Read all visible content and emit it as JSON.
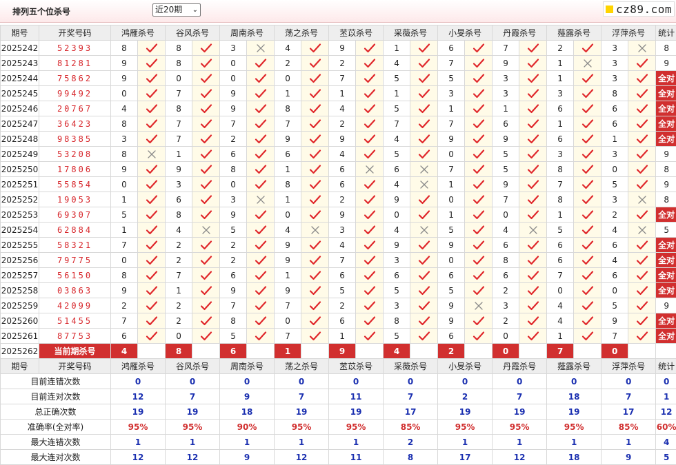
{
  "header": {
    "title": "排列五个位杀号",
    "range_selected": "近20期",
    "logo_text": "cz89.com"
  },
  "colors": {
    "accent_red": "#d12f2f",
    "draw_red": "#d7262b",
    "stat_blue": "#1a2fb0",
    "mark_bg": "#fffbe8",
    "logo_yellow": "#ffd400"
  },
  "columns": {
    "period": "期号",
    "draw": "开奖号码",
    "experts": [
      "鸿雁杀号",
      "谷风杀号",
      "周南杀号",
      "荡之杀号",
      "苤苡杀号",
      "采薇杀号",
      "小旻杀号",
      "丹霞杀号",
      "薤露杀号",
      "浮萍杀号"
    ],
    "stat": "统计"
  },
  "rows": [
    {
      "period": "2025242",
      "draw": "52393",
      "kills": [
        [
          8,
          1
        ],
        [
          8,
          1
        ],
        [
          3,
          0
        ],
        [
          4,
          1
        ],
        [
          9,
          1
        ],
        [
          1,
          1
        ],
        [
          6,
          1
        ],
        [
          7,
          1
        ],
        [
          2,
          1
        ],
        [
          3,
          0
        ]
      ],
      "stat": "8"
    },
    {
      "period": "2025243",
      "draw": "81281",
      "kills": [
        [
          9,
          1
        ],
        [
          8,
          1
        ],
        [
          0,
          1
        ],
        [
          2,
          1
        ],
        [
          2,
          1
        ],
        [
          4,
          1
        ],
        [
          7,
          1
        ],
        [
          9,
          1
        ],
        [
          1,
          0
        ],
        [
          3,
          1
        ]
      ],
      "stat": "9"
    },
    {
      "period": "2025244",
      "draw": "75862",
      "kills": [
        [
          9,
          1
        ],
        [
          0,
          1
        ],
        [
          0,
          1
        ],
        [
          0,
          1
        ],
        [
          7,
          1
        ],
        [
          5,
          1
        ],
        [
          5,
          1
        ],
        [
          3,
          1
        ],
        [
          1,
          1
        ],
        [
          3,
          1
        ]
      ],
      "stat": "全对"
    },
    {
      "period": "2025245",
      "draw": "99492",
      "kills": [
        [
          0,
          1
        ],
        [
          7,
          1
        ],
        [
          9,
          1
        ],
        [
          1,
          1
        ],
        [
          1,
          1
        ],
        [
          1,
          1
        ],
        [
          3,
          1
        ],
        [
          3,
          1
        ],
        [
          3,
          1
        ],
        [
          8,
          1
        ]
      ],
      "stat": "全对"
    },
    {
      "period": "2025246",
      "draw": "20767",
      "kills": [
        [
          4,
          1
        ],
        [
          8,
          1
        ],
        [
          9,
          1
        ],
        [
          8,
          1
        ],
        [
          4,
          1
        ],
        [
          5,
          1
        ],
        [
          1,
          1
        ],
        [
          1,
          1
        ],
        [
          6,
          1
        ],
        [
          6,
          1
        ]
      ],
      "stat": "全对"
    },
    {
      "period": "2025247",
      "draw": "36423",
      "kills": [
        [
          8,
          1
        ],
        [
          7,
          1
        ],
        [
          7,
          1
        ],
        [
          7,
          1
        ],
        [
          2,
          1
        ],
        [
          7,
          1
        ],
        [
          7,
          1
        ],
        [
          6,
          1
        ],
        [
          1,
          1
        ],
        [
          6,
          1
        ]
      ],
      "stat": "全对"
    },
    {
      "period": "2025248",
      "draw": "98385",
      "kills": [
        [
          3,
          1
        ],
        [
          7,
          1
        ],
        [
          2,
          1
        ],
        [
          9,
          1
        ],
        [
          9,
          1
        ],
        [
          4,
          1
        ],
        [
          9,
          1
        ],
        [
          9,
          1
        ],
        [
          6,
          1
        ],
        [
          1,
          1
        ]
      ],
      "stat": "全对"
    },
    {
      "period": "2025249",
      "draw": "53208",
      "kills": [
        [
          8,
          0
        ],
        [
          1,
          1
        ],
        [
          6,
          1
        ],
        [
          6,
          1
        ],
        [
          4,
          1
        ],
        [
          5,
          1
        ],
        [
          0,
          1
        ],
        [
          5,
          1
        ],
        [
          3,
          1
        ],
        [
          3,
          1
        ]
      ],
      "stat": "9"
    },
    {
      "period": "2025250",
      "draw": "17806",
      "kills": [
        [
          9,
          1
        ],
        [
          9,
          1
        ],
        [
          8,
          1
        ],
        [
          1,
          1
        ],
        [
          6,
          0
        ],
        [
          6,
          0
        ],
        [
          7,
          1
        ],
        [
          5,
          1
        ],
        [
          8,
          1
        ],
        [
          0,
          1
        ]
      ],
      "stat": "8"
    },
    {
      "period": "2025251",
      "draw": "55854",
      "kills": [
        [
          0,
          1
        ],
        [
          3,
          1
        ],
        [
          0,
          1
        ],
        [
          8,
          1
        ],
        [
          6,
          1
        ],
        [
          4,
          0
        ],
        [
          1,
          1
        ],
        [
          9,
          1
        ],
        [
          7,
          1
        ],
        [
          5,
          1
        ]
      ],
      "stat": "9"
    },
    {
      "period": "2025252",
      "draw": "19053",
      "kills": [
        [
          1,
          1
        ],
        [
          6,
          1
        ],
        [
          3,
          0
        ],
        [
          1,
          1
        ],
        [
          2,
          1
        ],
        [
          9,
          1
        ],
        [
          0,
          1
        ],
        [
          7,
          1
        ],
        [
          8,
          1
        ],
        [
          3,
          0
        ]
      ],
      "stat": "8"
    },
    {
      "period": "2025253",
      "draw": "69307",
      "kills": [
        [
          5,
          1
        ],
        [
          8,
          1
        ],
        [
          9,
          1
        ],
        [
          0,
          1
        ],
        [
          9,
          1
        ],
        [
          0,
          1
        ],
        [
          1,
          1
        ],
        [
          0,
          1
        ],
        [
          1,
          1
        ],
        [
          2,
          1
        ]
      ],
      "stat": "全对"
    },
    {
      "period": "2025254",
      "draw": "62884",
      "kills": [
        [
          1,
          1
        ],
        [
          4,
          0
        ],
        [
          5,
          1
        ],
        [
          4,
          0
        ],
        [
          3,
          1
        ],
        [
          4,
          0
        ],
        [
          5,
          1
        ],
        [
          4,
          0
        ],
        [
          5,
          1
        ],
        [
          4,
          0
        ]
      ],
      "stat": "5"
    },
    {
      "period": "2025255",
      "draw": "58321",
      "kills": [
        [
          7,
          1
        ],
        [
          2,
          1
        ],
        [
          2,
          1
        ],
        [
          9,
          1
        ],
        [
          4,
          1
        ],
        [
          9,
          1
        ],
        [
          9,
          1
        ],
        [
          6,
          1
        ],
        [
          6,
          1
        ],
        [
          6,
          1
        ]
      ],
      "stat": "全对"
    },
    {
      "period": "2025256",
      "draw": "79775",
      "kills": [
        [
          0,
          1
        ],
        [
          2,
          1
        ],
        [
          2,
          1
        ],
        [
          9,
          1
        ],
        [
          7,
          1
        ],
        [
          3,
          1
        ],
        [
          0,
          1
        ],
        [
          8,
          1
        ],
        [
          6,
          1
        ],
        [
          4,
          1
        ]
      ],
      "stat": "全对"
    },
    {
      "period": "2025257",
      "draw": "56150",
      "kills": [
        [
          8,
          1
        ],
        [
          7,
          1
        ],
        [
          6,
          1
        ],
        [
          1,
          1
        ],
        [
          6,
          1
        ],
        [
          6,
          1
        ],
        [
          6,
          1
        ],
        [
          6,
          1
        ],
        [
          7,
          1
        ],
        [
          6,
          1
        ]
      ],
      "stat": "全对"
    },
    {
      "period": "2025258",
      "draw": "03863",
      "kills": [
        [
          9,
          1
        ],
        [
          1,
          1
        ],
        [
          9,
          1
        ],
        [
          9,
          1
        ],
        [
          5,
          1
        ],
        [
          5,
          1
        ],
        [
          5,
          1
        ],
        [
          2,
          1
        ],
        [
          0,
          1
        ],
        [
          0,
          1
        ]
      ],
      "stat": "全对"
    },
    {
      "period": "2025259",
      "draw": "42099",
      "kills": [
        [
          2,
          1
        ],
        [
          2,
          1
        ],
        [
          7,
          1
        ],
        [
          7,
          1
        ],
        [
          2,
          1
        ],
        [
          3,
          1
        ],
        [
          9,
          0
        ],
        [
          3,
          1
        ],
        [
          4,
          1
        ],
        [
          5,
          1
        ]
      ],
      "stat": "9"
    },
    {
      "period": "2025260",
      "draw": "51455",
      "kills": [
        [
          7,
          1
        ],
        [
          2,
          1
        ],
        [
          8,
          1
        ],
        [
          0,
          1
        ],
        [
          6,
          1
        ],
        [
          8,
          1
        ],
        [
          9,
          1
        ],
        [
          2,
          1
        ],
        [
          4,
          1
        ],
        [
          9,
          1
        ]
      ],
      "stat": "全对"
    },
    {
      "period": "2025261",
      "draw": "87753",
      "kills": [
        [
          6,
          1
        ],
        [
          0,
          1
        ],
        [
          5,
          1
        ],
        [
          7,
          1
        ],
        [
          1,
          1
        ],
        [
          5,
          1
        ],
        [
          6,
          1
        ],
        [
          0,
          1
        ],
        [
          1,
          1
        ],
        [
          7,
          1
        ]
      ],
      "stat": "全对"
    }
  ],
  "current": {
    "period": "2025262",
    "label": "当前期杀号",
    "values": [
      "4",
      "8",
      "6",
      "1",
      "9",
      "4",
      "2",
      "0",
      "7",
      "0"
    ]
  },
  "stats": [
    {
      "label": "目前连错次数",
      "values": [
        "0",
        "0",
        "0",
        "0",
        "0",
        "0",
        "0",
        "0",
        "0",
        "0"
      ],
      "total": "0",
      "type": "blue"
    },
    {
      "label": "目前连对次数",
      "values": [
        "12",
        "7",
        "9",
        "7",
        "11",
        "7",
        "2",
        "7",
        "18",
        "7"
      ],
      "total": "1",
      "type": "blue"
    },
    {
      "label": "总正确次数",
      "values": [
        "19",
        "19",
        "18",
        "19",
        "19",
        "17",
        "19",
        "19",
        "19",
        "17"
      ],
      "total": "12",
      "type": "blue"
    },
    {
      "label": "准确率(全对率)",
      "values": [
        "95%",
        "95%",
        "90%",
        "95%",
        "95%",
        "85%",
        "95%",
        "95%",
        "95%",
        "85%"
      ],
      "total": "60%",
      "type": "red"
    },
    {
      "label": "最大连错次数",
      "values": [
        "1",
        "1",
        "1",
        "1",
        "1",
        "2",
        "1",
        "1",
        "1",
        "1"
      ],
      "total": "4",
      "type": "blue"
    },
    {
      "label": "最大连对次数",
      "values": [
        "12",
        "12",
        "9",
        "12",
        "11",
        "8",
        "17",
        "12",
        "18",
        "9"
      ],
      "total": "5",
      "type": "blue"
    }
  ]
}
